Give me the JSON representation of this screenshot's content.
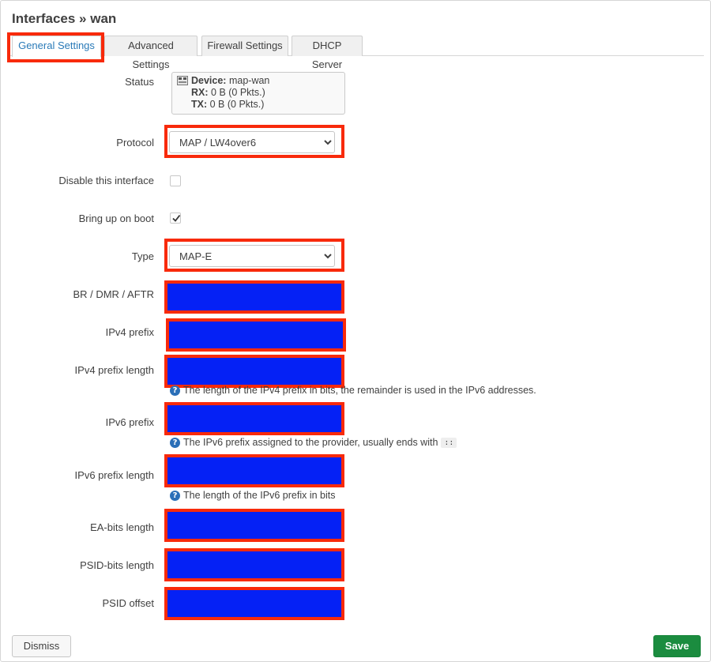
{
  "window": {
    "title": "Interfaces » wan"
  },
  "tabs": [
    {
      "label": "General Settings",
      "active": true
    },
    {
      "label": "Advanced Settings",
      "active": false
    },
    {
      "label": "Firewall Settings",
      "active": false
    },
    {
      "label": "DHCP Server",
      "active": false
    }
  ],
  "status": {
    "label": "Status",
    "device_key": "Device:",
    "device_value": "map-wan",
    "rx_key": "RX:",
    "rx_value": "0 B (0 Pkts.)",
    "tx_key": "TX:",
    "tx_value": "0 B (0 Pkts.)",
    "icon": "network-device-icon"
  },
  "protocol": {
    "label": "Protocol",
    "value": "MAP / LW4over6"
  },
  "disable_interface": {
    "label": "Disable this interface",
    "checked": false
  },
  "bring_up_on_boot": {
    "label": "Bring up on boot",
    "checked": true
  },
  "type": {
    "label": "Type",
    "value": "MAP-E"
  },
  "fields": {
    "br_dmr_aftr": {
      "label": "BR / DMR / AFTR"
    },
    "ipv4_prefix": {
      "label": "IPv4 prefix"
    },
    "ipv4_prefix_length": {
      "label": "IPv4 prefix length",
      "hint": "The length of the IPv4 prefix in bits, the remainder is used in the IPv6 addresses."
    },
    "ipv6_prefix": {
      "label": "IPv6 prefix",
      "hint": "The IPv6 prefix assigned to the provider, usually ends with",
      "hint_code": "::"
    },
    "ipv6_prefix_length": {
      "label": "IPv6 prefix length",
      "hint": "The length of the IPv6 prefix in bits"
    },
    "ea_bits_length": {
      "label": "EA-bits length"
    },
    "psid_bits_length": {
      "label": "PSID-bits length"
    },
    "psid_offset": {
      "label": "PSID offset"
    }
  },
  "buttons": {
    "dismiss": "Dismiss",
    "save": "Save"
  },
  "colors": {
    "highlight": "#f82a0b",
    "redaction": "#0521f5",
    "save": "#1b8c3f",
    "tab_active": "#2a7ab8"
  }
}
